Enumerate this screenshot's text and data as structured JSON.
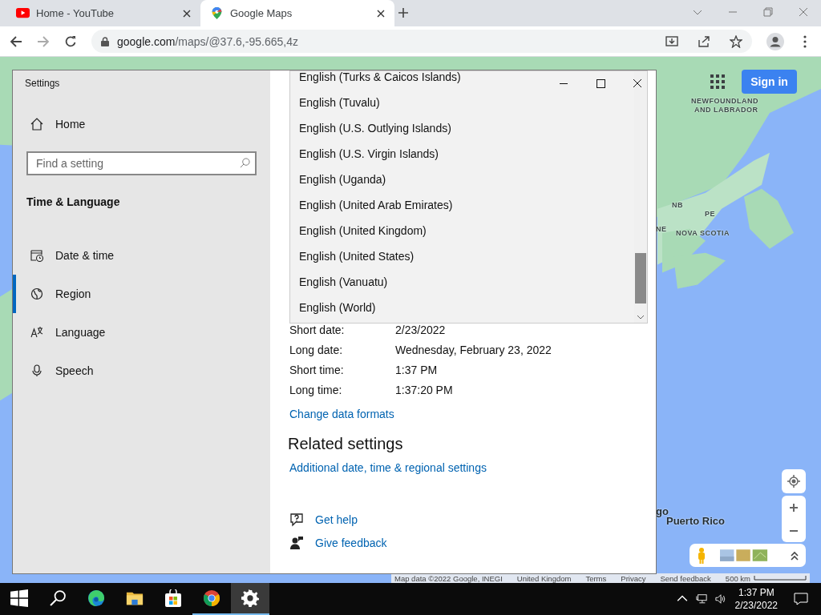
{
  "browser": {
    "tabs": [
      {
        "title": "Home - YouTube",
        "kind": "youtube",
        "selected": false
      },
      {
        "title": "Google Maps",
        "kind": "maps",
        "selected": true
      }
    ],
    "address_host": "google.com",
    "address_path": "/maps/@37.6,-95.665,4z"
  },
  "map": {
    "sign_in": "Sign in",
    "labels": [
      {
        "text": "NEWFOUNDLAND",
        "kind": "region"
      },
      {
        "text": "AND LABRADOR",
        "kind": "region"
      },
      {
        "text": "NB",
        "kind": "region"
      },
      {
        "text": "PE",
        "kind": "region"
      },
      {
        "text": "NE",
        "kind": "region"
      },
      {
        "text": "NOVA SCOTIA",
        "kind": "region"
      },
      {
        "text": "go",
        "kind": "place"
      },
      {
        "text": "Puerto Rico",
        "kind": "place"
      }
    ],
    "attribution": [
      "Map data ©2022 Google, INEGI",
      "United Kingdom",
      "Terms",
      "Privacy",
      "Send feedback"
    ],
    "scale": "500 km"
  },
  "settings": {
    "title": "Settings",
    "home": "Home",
    "search": {
      "placeholder": "Find a setting"
    },
    "section": "Time & Language",
    "nav": [
      {
        "label": "Date & time",
        "kind": "date",
        "selected": false
      },
      {
        "label": "Region",
        "kind": "region",
        "selected": true
      },
      {
        "label": "Language",
        "kind": "language",
        "selected": false
      },
      {
        "label": "Speech",
        "kind": "speech",
        "selected": false
      }
    ],
    "dropdown": [
      "English (Turks & Caicos Islands)",
      "English (Tuvalu)",
      "English (U.S. Outlying Islands)",
      "English (U.S. Virgin Islands)",
      "English (Uganda)",
      "English (United Arab Emirates)",
      "English (United Kingdom)",
      "English (United States)",
      "English (Vanuatu)",
      "English (World)"
    ],
    "formats": [
      {
        "label": "Short date:",
        "value": "2/23/2022"
      },
      {
        "label": "Long date:",
        "value": "Wednesday, February 23, 2022"
      },
      {
        "label": "Short time:",
        "value": "1:37 PM"
      },
      {
        "label": "Long time:",
        "value": "1:37:20 PM"
      }
    ],
    "change_link": "Change data formats",
    "related_heading": "Related settings",
    "related_link": "Additional date, time & regional settings",
    "help": [
      {
        "kind": "help",
        "label": "Get help"
      },
      {
        "kind": "feedback",
        "label": "Give feedback"
      }
    ]
  },
  "taskbar": {
    "apps": [
      {
        "kind": "start",
        "running": false,
        "selected": false
      },
      {
        "kind": "search",
        "running": false,
        "selected": false
      },
      {
        "kind": "edge",
        "running": false,
        "selected": false
      },
      {
        "kind": "explorer",
        "running": false,
        "selected": false
      },
      {
        "kind": "store",
        "running": false,
        "selected": false
      },
      {
        "kind": "chrome",
        "running": true,
        "selected": false
      },
      {
        "kind": "settings",
        "running": true,
        "selected": true
      }
    ],
    "time": "1:37 PM",
    "date": "2/23/2022"
  }
}
